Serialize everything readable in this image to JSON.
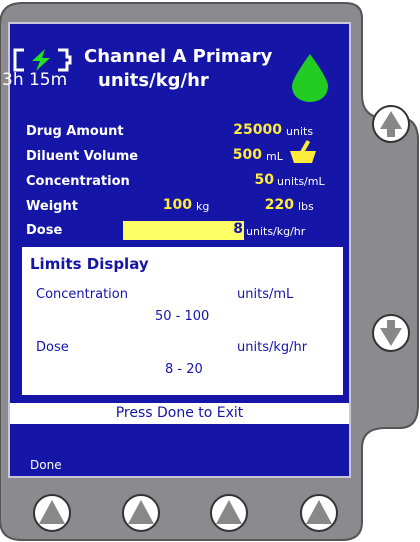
{
  "header": {
    "channel_title": "Channel A Primary",
    "elapsed_time": "3h 15m",
    "dose_units": "units/kg/hr"
  },
  "program": {
    "drug_amount": {
      "label": "Drug Amount",
      "value": "25000",
      "unit": "units"
    },
    "diluent_volume": {
      "label": "Diluent Volume",
      "value": "500",
      "unit": "mL"
    },
    "concentration": {
      "label": "Concentration",
      "value": "50",
      "unit": "units/mL"
    },
    "weight": {
      "label": "Weight",
      "value_kg": "100",
      "unit_kg": "kg",
      "value_lbs": "220",
      "unit_lbs": "lbs"
    },
    "dose": {
      "label": "Dose",
      "value": "8",
      "unit": "units/kg/hr"
    }
  },
  "limits": {
    "title": "Limits Display",
    "concentration": {
      "label": "Concentration",
      "unit": "units/mL",
      "range": "50 - 100"
    },
    "dose": {
      "label": "Dose",
      "unit": "units/kg/hr",
      "range": "8 - 20"
    }
  },
  "footer": {
    "prompt": "Press Done to Exit",
    "softkey_1": "Done"
  },
  "icons": {
    "battery": "battery-charging-icon",
    "drip": "fluid-drop-icon",
    "mortar": "mortar-pestle-icon",
    "up": "up-arrow-icon",
    "down": "down-arrow-icon"
  },
  "colors": {
    "screen_bg": "#1515a8",
    "value_yellow": "#ffeb3b",
    "dose_highlight": "#ffff66",
    "drop_green": "#22cc22"
  }
}
